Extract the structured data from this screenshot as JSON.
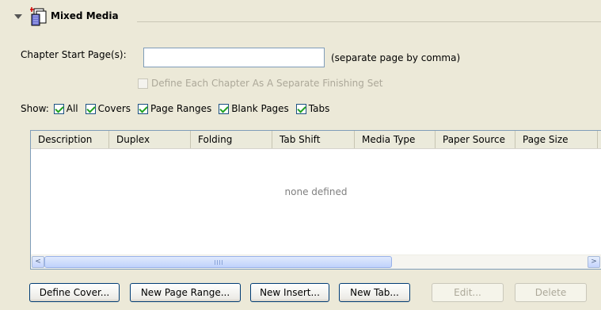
{
  "section": {
    "title": "Mixed Media"
  },
  "chapter": {
    "label": "Chapter Start Page(s):",
    "value": "",
    "hint": "(separate page by comma)"
  },
  "finishing": {
    "label": "Define Each Chapter As A Separate Finishing Set",
    "checked": false,
    "enabled": false
  },
  "show": {
    "label": "Show:",
    "options": [
      {
        "label": "All",
        "checked": true
      },
      {
        "label": "Covers",
        "checked": true
      },
      {
        "label": "Page Ranges",
        "checked": true
      },
      {
        "label": "Blank Pages",
        "checked": true
      },
      {
        "label": "Tabs",
        "checked": true
      }
    ]
  },
  "table": {
    "columns": [
      "Description",
      "Duplex",
      "Folding",
      "Tab Shift",
      "Media Type",
      "Paper Source",
      "Page Size"
    ],
    "empty_message": "none defined"
  },
  "scrollbar": {
    "left_arrow": "<",
    "right_arrow": ">"
  },
  "buttons": {
    "define_cover": "Define Cover...",
    "new_page_range": "New Page Range...",
    "new_insert": "New Insert...",
    "new_tab": "New Tab...",
    "edit": "Edit...",
    "delete": "Delete"
  },
  "colors": {
    "background": "#ece9d8",
    "checkmark": "#21a121",
    "input_border": "#7f9db9"
  }
}
